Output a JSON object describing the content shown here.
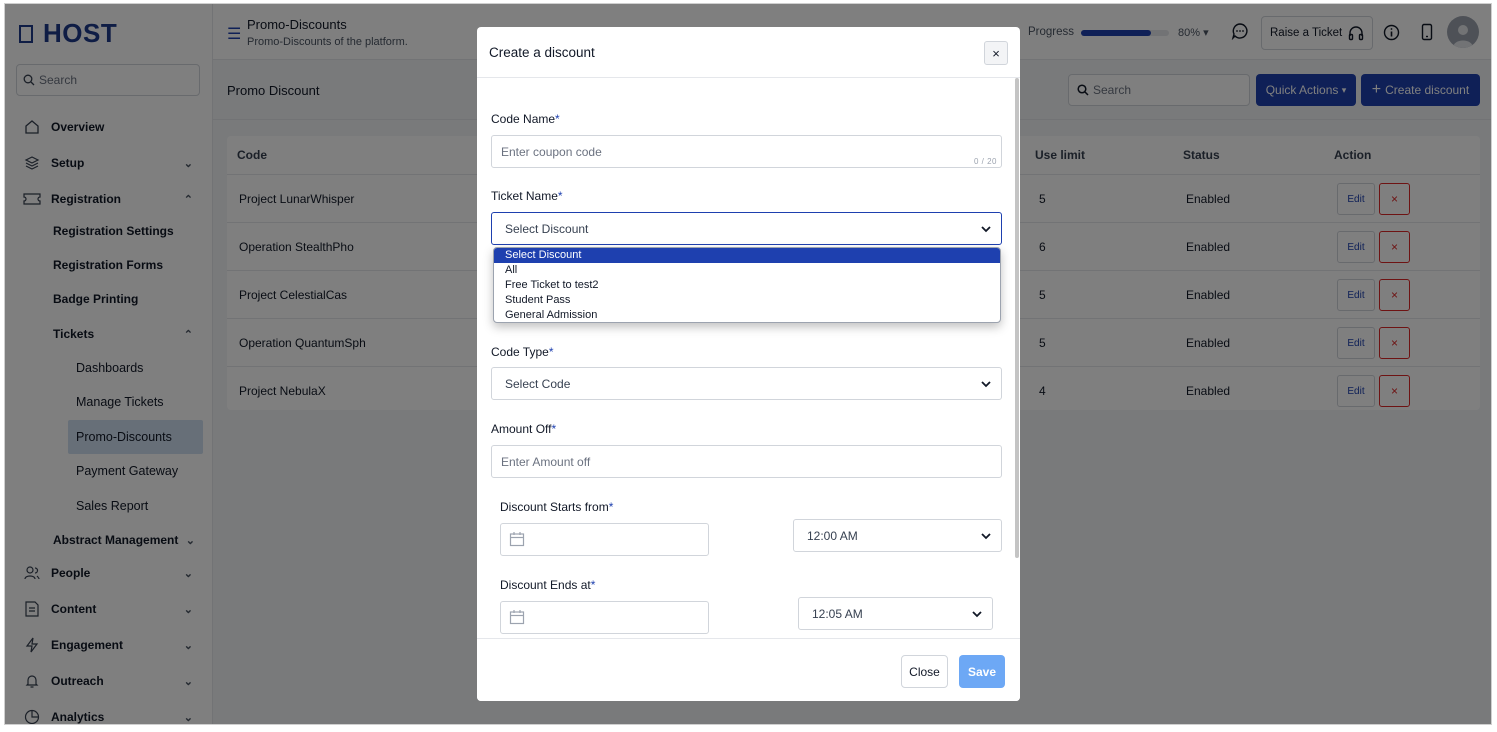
{
  "sidebar": {
    "logo_text": "HOST",
    "search_placeholder": "Search",
    "items": [
      {
        "label": "Overview"
      },
      {
        "label": "Setup"
      },
      {
        "label": "Registration"
      },
      {
        "label": "Registration Settings"
      },
      {
        "label": "Registration Forms"
      },
      {
        "label": "Badge Printing"
      },
      {
        "label": "Tickets"
      },
      {
        "label": "Dashboards"
      },
      {
        "label": "Manage Tickets"
      },
      {
        "label": "Promo-Discounts"
      },
      {
        "label": "Payment Gateway"
      },
      {
        "label": "Sales Report"
      },
      {
        "label": "Abstract Management"
      },
      {
        "label": "People"
      },
      {
        "label": "Content"
      },
      {
        "label": "Engagement"
      },
      {
        "label": "Outreach"
      },
      {
        "label": "Analytics"
      }
    ]
  },
  "header": {
    "title": "Promo-Discounts",
    "subtitle": "Promo-Discounts of the platform.",
    "progress_label": "Progress",
    "progress_value": "80%",
    "progress_fraction": 0.8,
    "raise_ticket": "Raise a Ticket"
  },
  "main": {
    "section_title": "Promo Discount",
    "search_placeholder": "Search",
    "quick_actions": "Quick Actions",
    "create_discount": "Create discount",
    "columns": {
      "code": "Code",
      "use_limit": "Use limit",
      "status": "Status",
      "action": "Action"
    },
    "rows": [
      {
        "code": "Project LunarWhisper",
        "use_limit": "5",
        "status": "Enabled"
      },
      {
        "code": "Operation StealthPho",
        "use_limit": "6",
        "status": "Enabled"
      },
      {
        "code": "Project CelestialCas",
        "use_limit": "5",
        "status": "Enabled"
      },
      {
        "code": "Operation QuantumSph",
        "use_limit": "5",
        "status": "Enabled"
      },
      {
        "code": "Project NebulaX",
        "use_limit": "4",
        "status": "Enabled"
      }
    ],
    "edit_label": "Edit",
    "delete_label": "×"
  },
  "modal": {
    "title": "Create a discount",
    "close_x": "×",
    "code_name_label": "Code Name",
    "code_name_placeholder": "Enter coupon code",
    "code_name_counter": "0 / 20",
    "ticket_name_label": "Ticket Name",
    "ticket_select_value": "Select Discount",
    "ticket_options": [
      "Select Discount",
      "All",
      "Free Ticket to test2",
      "Student Pass",
      "General Admission"
    ],
    "code_type_label": "Code Type",
    "code_type_value": "Select Code",
    "amount_off_label": "Amount Off",
    "amount_off_placeholder": "Enter Amount off",
    "starts_label": "Discount Starts from",
    "starts_time": "12:00 AM",
    "ends_label": "Discount Ends at",
    "ends_time": "12:05 AM",
    "required_mark": "*",
    "close_button": "Close",
    "save_button": "Save"
  }
}
